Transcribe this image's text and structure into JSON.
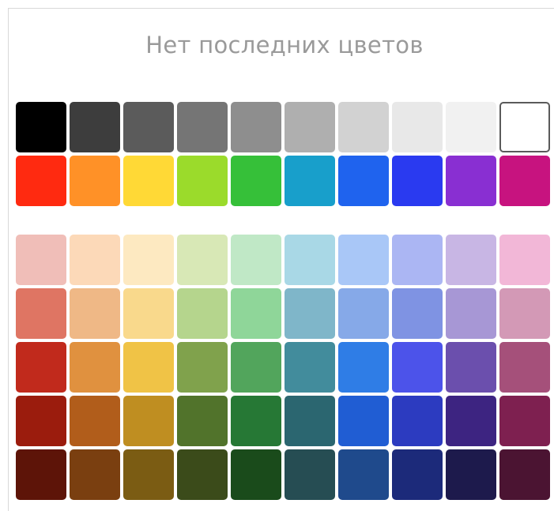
{
  "recent": {
    "empty_text": "Нет последних цветов"
  },
  "basic_colors": [
    [
      "#000000",
      "#3d3d3d",
      "#5b5b5b",
      "#757575",
      "#8e8e8e",
      "#afafaf",
      "#d2d2d2",
      "#e8e8e8",
      "#f1f1f1",
      "#ffffff"
    ],
    [
      "#ff2a10",
      "#ff9127",
      "#ffd936",
      "#9bdb2b",
      "#36c039",
      "#189fcb",
      "#1f63ee",
      "#2a3af0",
      "#892fd2",
      "#c7137f"
    ]
  ],
  "palette_colors": [
    [
      "#f0beb8",
      "#fcd9b8",
      "#fde9c1",
      "#d8e8b6",
      "#c0e8c6",
      "#a9d8e6",
      "#a9c7f7",
      "#abb6f3",
      "#c8b6e4",
      "#f2b7d7"
    ],
    [
      "#df7563",
      "#efb886",
      "#f9d98c",
      "#b5d58d",
      "#8fd699",
      "#7fb6c9",
      "#86a9e8",
      "#7f93e3",
      "#a797d5",
      "#d399b6"
    ],
    [
      "#c12a1c",
      "#e0913f",
      "#f0c346",
      "#80a24c",
      "#52a55c",
      "#428c9c",
      "#2f7de6",
      "#4c53ea",
      "#6b4fad",
      "#a5507a"
    ],
    [
      "#9b1c0d",
      "#b15d1b",
      "#bf8e21",
      "#51732b",
      "#267835",
      "#2b6670",
      "#205dd3",
      "#2c3bc0",
      "#3d2481",
      "#7e2050"
    ],
    [
      "#5d1408",
      "#7a3f10",
      "#7b5c13",
      "#3b4b1a",
      "#1a4b1b",
      "#264d53",
      "#1f4a8c",
      "#1c2a7a",
      "#1d1a4c",
      "#4b1432"
    ]
  ],
  "selected_color": "#ffffff"
}
